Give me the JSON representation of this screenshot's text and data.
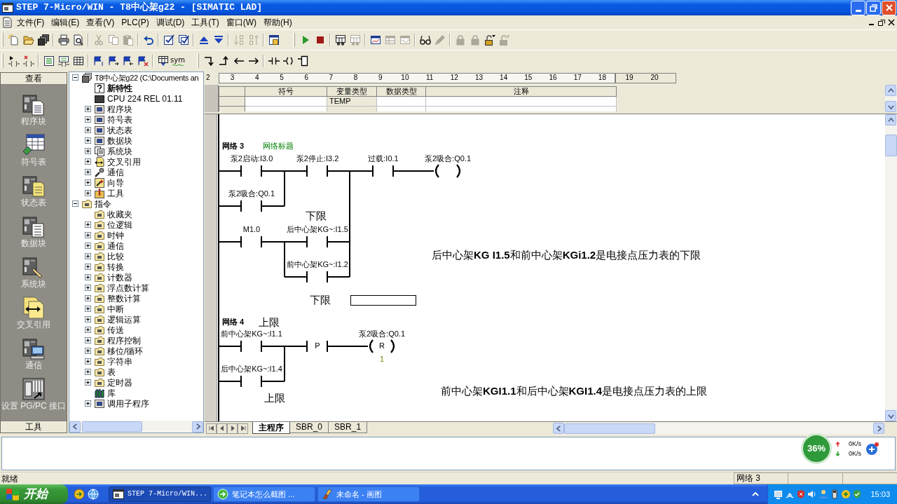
{
  "window": {
    "title": "STEP 7-Micro/WIN - T8中心架g22 - [SIMATIC LAD]"
  },
  "menu": [
    "文件(F)",
    "编辑(E)",
    "查看(V)",
    "PLC(P)",
    "调试(D)",
    "工具(T)",
    "窗口(W)",
    "帮助(H)"
  ],
  "toolbar_rows": [
    [
      {
        "groups": [
          [
            {
              "kind": "new",
              "disabled": false
            },
            {
              "kind": "open",
              "disabled": false
            },
            {
              "kind": "saveall",
              "disabled": false
            }
          ],
          [
            {
              "kind": "print",
              "disabled": false
            },
            {
              "kind": "preview",
              "disabled": false
            }
          ],
          [
            {
              "kind": "cut",
              "disabled": true
            },
            {
              "kind": "copy",
              "disabled": true
            },
            {
              "kind": "paste",
              "disabled": true
            }
          ],
          [
            {
              "kind": "undo",
              "disabled": false
            }
          ],
          [
            {
              "kind": "compile",
              "disabled": false
            },
            {
              "kind": "compileall",
              "disabled": false
            }
          ],
          [
            {
              "kind": "upload",
              "disabled": false
            },
            {
              "kind": "download",
              "disabled": false
            }
          ],
          [
            {
              "kind": "sortasc",
              "disabled": true
            },
            {
              "kind": "sortdesc",
              "disabled": true
            }
          ],
          [
            {
              "kind": "options",
              "disabled": false
            }
          ]
        ]
      },
      {
        "groups": [
          [
            {
              "kind": "run",
              "disabled": false
            },
            {
              "kind": "stop",
              "disabled": false
            }
          ],
          [
            {
              "kind": "status",
              "disabled": false
            },
            {
              "kind": "status",
              "disabled": true
            }
          ],
          [
            {
              "kind": "chart",
              "disabled": false
            },
            {
              "kind": "table",
              "disabled": true
            },
            {
              "kind": "trend",
              "disabled": true
            }
          ],
          [
            {
              "kind": "glasses",
              "disabled": false
            },
            {
              "kind": "pencil",
              "disabled": true
            }
          ],
          [
            {
              "kind": "lock",
              "disabled": true
            },
            {
              "kind": "lock",
              "disabled": true
            },
            {
              "kind": "unlock",
              "disabled": false
            },
            {
              "kind": "unlockarrow",
              "disabled": true
            }
          ]
        ]
      }
    ],
    [
      {
        "groups": [
          [
            {
              "kind": "insertnet",
              "disabled": false
            },
            {
              "kind": "deletenet",
              "disabled": false
            }
          ],
          [
            {
              "kind": "checklist",
              "disabled": false
            },
            {
              "kind": "listcoil",
              "disabled": false
            },
            {
              "kind": "grid",
              "disabled": false
            }
          ],
          [
            {
              "kind": "bookmark",
              "disabled": false
            },
            {
              "kind": "bookmarknext",
              "disabled": false
            },
            {
              "kind": "bookmarkprev",
              "disabled": false
            },
            {
              "kind": "bookmarkdel",
              "disabled": false
            }
          ],
          [
            {
              "kind": "tablearrow",
              "disabled": false
            },
            {
              "kind": "sym",
              "label": "sym",
              "disabled": false
            }
          ]
        ]
      },
      {
        "groups": [
          [
            {
              "kind": "linedown",
              "disabled": false
            },
            {
              "kind": "lineup",
              "disabled": false
            },
            {
              "kind": "left",
              "disabled": false
            },
            {
              "kind": "right",
              "disabled": false
            }
          ],
          [
            {
              "kind": "contact",
              "disabled": false
            },
            {
              "kind": "coil",
              "disabled": false
            },
            {
              "kind": "box",
              "disabled": false
            }
          ]
        ]
      }
    ]
  ],
  "nav_bar": {
    "header": "查看",
    "items": [
      {
        "kind": "program",
        "label": "程序块"
      },
      {
        "kind": "symbols",
        "label": "符号表"
      },
      {
        "kind": "status",
        "label": "状态表"
      },
      {
        "kind": "data",
        "label": "数据块"
      },
      {
        "kind": "system",
        "label": "系统块"
      },
      {
        "kind": "crossref",
        "label": "交叉引用"
      },
      {
        "kind": "comm",
        "label": "通信"
      },
      {
        "kind": "setpg",
        "label": "设置 PG/PC 接口"
      }
    ],
    "footer": "工具"
  },
  "tree": [
    {
      "kind": "project",
      "label": "T8中心架g22 (C:\\Documents an",
      "expanded": true,
      "children": [
        {
          "kind": "help",
          "label": "新特性"
        },
        {
          "kind": "cpu",
          "label": "CPU 224 REL 01.11"
        },
        {
          "kind": "block",
          "label": "程序块",
          "expanded": false
        },
        {
          "kind": "block",
          "label": "符号表",
          "expanded": false
        },
        {
          "kind": "block",
          "label": "状态表",
          "expanded": false
        },
        {
          "kind": "block",
          "label": "数据块",
          "expanded": false
        },
        {
          "kind": "docs",
          "label": "系统块",
          "expanded": false
        },
        {
          "kind": "crossref",
          "label": "交叉引用",
          "expanded": false
        },
        {
          "kind": "comm",
          "label": "通信",
          "expanded": false
        },
        {
          "kind": "wand",
          "label": "向导",
          "expanded": false
        },
        {
          "kind": "tools",
          "label": "工具",
          "expanded": false
        }
      ]
    },
    {
      "kind": "folder",
      "label": "指令",
      "expanded": true,
      "children": [
        {
          "kind": "folder",
          "label": "收藏夹"
        },
        {
          "kind": "folder",
          "label": "位逻辑",
          "expanded": false
        },
        {
          "kind": "folder",
          "label": "时钟",
          "expanded": false
        },
        {
          "kind": "folder",
          "label": "通信",
          "expanded": false
        },
        {
          "kind": "folder",
          "label": "比较",
          "expanded": false
        },
        {
          "kind": "folder",
          "label": "转换",
          "expanded": false
        },
        {
          "kind": "folder",
          "label": "计数器",
          "expanded": false
        },
        {
          "kind": "folder",
          "label": "浮点数计算",
          "expanded": false
        },
        {
          "kind": "folder",
          "label": "整数计算",
          "expanded": false
        },
        {
          "kind": "folder",
          "label": "中断",
          "expanded": false
        },
        {
          "kind": "folder",
          "label": "逻辑运算",
          "expanded": false
        },
        {
          "kind": "folder",
          "label": "传送",
          "expanded": false
        },
        {
          "kind": "folder",
          "label": "程序控制",
          "expanded": false
        },
        {
          "kind": "folder",
          "label": "移位/循环",
          "expanded": false
        },
        {
          "kind": "folder",
          "label": "字符串",
          "expanded": false
        },
        {
          "kind": "folder",
          "label": "表",
          "expanded": false
        },
        {
          "kind": "folder",
          "label": "定时器",
          "expanded": false
        },
        {
          "kind": "library",
          "label": "库"
        },
        {
          "kind": "block",
          "label": "调用子程序",
          "expanded": false
        }
      ]
    }
  ],
  "editor": {
    "ruler": [
      "2",
      "3",
      "4",
      "5",
      "6",
      "7",
      "8",
      "9",
      "10",
      "11",
      "12",
      "13",
      "14",
      "15",
      "16",
      "17",
      "18",
      "19",
      "20"
    ],
    "variable_table": {
      "columns": [
        "符号",
        "变量类型",
        "数据类型",
        "注释"
      ],
      "rows": [
        {
          "var_type": "TEMP"
        }
      ]
    },
    "networks": [
      {
        "title": "网络 3",
        "comment_title": "网络标题",
        "elements": [
          {
            "kind": "contact",
            "operand": "泵2启动:I3.0"
          },
          {
            "kind": "contact",
            "operand": "泵2停止:I3.2"
          },
          {
            "kind": "contact",
            "operand": "过载:I0.1"
          },
          {
            "kind": "coil",
            "operand": "泵2吸合:Q0.1"
          },
          {
            "kind": "contact",
            "operand": "泵2吸合:Q0.1"
          },
          {
            "kind": "contact",
            "operand": "M1.0"
          },
          {
            "kind": "contact",
            "operand": "后中心架KG~:I1.5"
          },
          {
            "kind": "contact",
            "operand": "前中心架KG~:I1.2"
          }
        ],
        "notes": [
          {
            "kind": "label",
            "text": "下限"
          },
          {
            "kind": "comment",
            "text": "后中心架**KG I1.5**和前中心架**KGi1.2**是电接点压力表的下限"
          },
          {
            "kind": "label",
            "text": "下限"
          },
          {
            "kind": "box"
          }
        ]
      },
      {
        "title": "网络 4",
        "elements": [
          {
            "kind": "contact",
            "operand": "前中心架KG~:I1.1"
          },
          {
            "kind": "transition",
            "label": "P"
          },
          {
            "kind": "coil",
            "operand": "泵2吸合:Q0.1",
            "instruction": "R",
            "count": "1"
          },
          {
            "kind": "contact",
            "operand": "后中心架KG~:I1.4"
          }
        ],
        "notes": [
          {
            "kind": "label",
            "text": "上限"
          },
          {
            "kind": "label",
            "text": "上限"
          },
          {
            "kind": "comment",
            "text": "前中心架**KGI1.1**和后中心架**KGI1.4**是电接点压力表的上限"
          }
        ]
      }
    ],
    "sheet_tabs": [
      {
        "label": "主程序",
        "selected": true
      },
      {
        "label": "SBR_0",
        "selected": false
      },
      {
        "label": "SBR_1",
        "selected": false
      }
    ]
  },
  "speed_widget": {
    "usage": "36%",
    "upload": "0K/s",
    "download": "0K/s"
  },
  "status_bar": {
    "message": "就绪",
    "network": "网络 3"
  },
  "taskbar": {
    "start": "开始",
    "tasks": [
      {
        "label": "STEP 7-Micro/WIN...",
        "selected": true
      },
      {
        "label": "笔记本怎么截图 ...",
        "selected": false
      },
      {
        "label": "未命名 - 画图",
        "selected": false
      }
    ],
    "clock": "15:03"
  }
}
